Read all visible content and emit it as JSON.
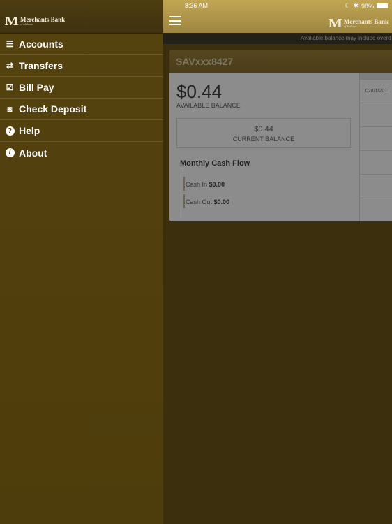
{
  "brand": {
    "name": "Merchants Bank",
    "sub": "of Alabama"
  },
  "sidebar": {
    "items": [
      {
        "label": "Accounts",
        "icon": "accounts-icon"
      },
      {
        "label": "Transfers",
        "icon": "transfers-icon"
      },
      {
        "label": "Bill Pay",
        "icon": "calendar-icon"
      },
      {
        "label": "Check Deposit",
        "icon": "camera-icon"
      },
      {
        "label": "Help",
        "icon": "help-icon"
      },
      {
        "label": "About",
        "icon": "info-icon"
      }
    ]
  },
  "status": {
    "time": "8:36 AM",
    "battery": "98%"
  },
  "notice": "Available balance may include overd",
  "account": {
    "name": "SAVxxx8427",
    "available_balance": "$0.44",
    "available_label": "AVAILABLE BALANCE",
    "current_balance": "$0.44",
    "current_label": "CURRENT BALANCE",
    "cash_flow_title": "Monthly Cash Flow",
    "cash_in_label": "Cash In",
    "cash_in": "$0.00",
    "cash_out_label": "Cash Out",
    "cash_out": "$0.00"
  },
  "transactions": [
    {
      "date": "02/01/201"
    }
  ]
}
